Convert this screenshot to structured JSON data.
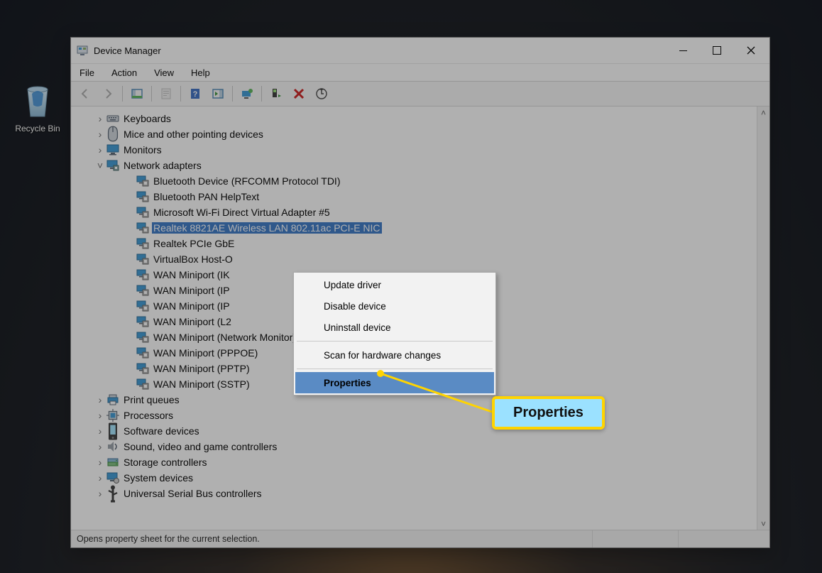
{
  "desktop": {
    "recycle_bin": "Recycle Bin"
  },
  "window": {
    "title": "Device Manager",
    "menu": {
      "file": "File",
      "action": "Action",
      "view": "View",
      "help": "Help"
    },
    "status": "Opens property sheet for the current selection."
  },
  "tree": {
    "cats": [
      {
        "name": "Keyboards",
        "icon": "keyboard",
        "expanded": false
      },
      {
        "name": "Mice and other pointing devices",
        "icon": "mouse",
        "expanded": false
      },
      {
        "name": "Monitors",
        "icon": "monitor",
        "expanded": false
      },
      {
        "name": "Network adapters",
        "icon": "network",
        "expanded": true,
        "children": [
          "Bluetooth Device (RFCOMM Protocol TDI)",
          "Bluetooth PAN HelpText",
          "Microsoft Wi-Fi Direct Virtual Adapter #5",
          "Realtek 8821AE Wireless LAN 802.11ac PCI-E NIC",
          "Realtek PCIe GbE",
          "VirtualBox Host-O",
          "WAN Miniport (IK",
          "WAN Miniport (IP",
          "WAN Miniport (IP",
          "WAN Miniport (L2",
          "WAN Miniport (Network Monitor)",
          "WAN Miniport (PPPOE)",
          "WAN Miniport (PPTP)",
          "WAN Miniport (SSTP)"
        ],
        "selected_index": 3
      },
      {
        "name": "Print queues",
        "icon": "printer",
        "expanded": false
      },
      {
        "name": "Processors",
        "icon": "cpu",
        "expanded": false
      },
      {
        "name": "Software devices",
        "icon": "software",
        "expanded": false
      },
      {
        "name": "Sound, video and game controllers",
        "icon": "sound",
        "expanded": false
      },
      {
        "name": "Storage controllers",
        "icon": "storage",
        "expanded": false
      },
      {
        "name": "System devices",
        "icon": "system",
        "expanded": false
      },
      {
        "name": "Universal Serial Bus controllers",
        "icon": "usb",
        "expanded": false
      }
    ]
  },
  "context_menu": {
    "items": [
      {
        "label": "Update driver"
      },
      {
        "label": "Disable device"
      },
      {
        "label": "Uninstall device"
      },
      {
        "sep": true
      },
      {
        "label": "Scan for hardware changes"
      },
      {
        "sep": true
      },
      {
        "label": "Properties",
        "selected": true
      }
    ]
  },
  "callout": {
    "label": "Properties"
  }
}
